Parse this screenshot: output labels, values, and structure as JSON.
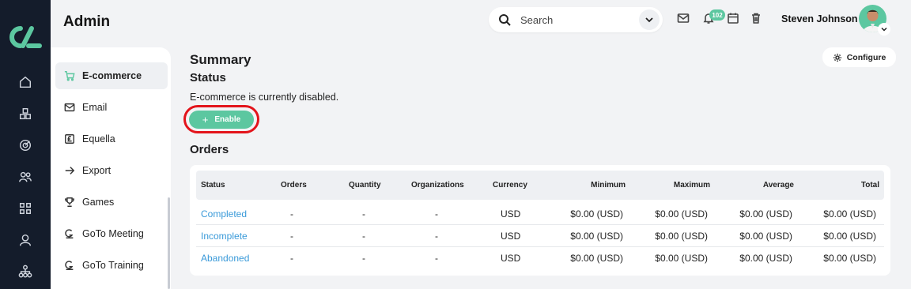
{
  "app": {
    "title": "Admin"
  },
  "colors": {
    "accent": "#5cc7a0",
    "rail": "#141c2b",
    "link": "#3a9ad9",
    "highlight_ring": "#e3141b"
  },
  "rail_icons": [
    "home-icon",
    "layers-icon",
    "target-icon",
    "users-icon",
    "grid-icon",
    "user-icon",
    "org-chart-icon"
  ],
  "header": {
    "search_placeholder": "Search",
    "notification_count": "102",
    "user_name": "Steven Johnson",
    "icons": [
      "mail-icon",
      "bell-icon",
      "calendar-icon",
      "trash-icon"
    ]
  },
  "subnav": {
    "items": [
      {
        "label": "E-commerce",
        "icon": "cart-icon",
        "active": true
      },
      {
        "label": "Email",
        "icon": "mail-icon"
      },
      {
        "label": "Equella",
        "icon": "pound-icon"
      },
      {
        "label": "Export",
        "icon": "arrow-right-icon"
      },
      {
        "label": "Games",
        "icon": "trophy-icon"
      },
      {
        "label": "GoTo Meeting",
        "icon": "goto-icon"
      },
      {
        "label": "GoTo Training",
        "icon": "goto-icon"
      }
    ]
  },
  "main": {
    "summary_title": "Summary",
    "status_title": "Status",
    "status_text": "E-commerce is currently disabled.",
    "enable_label": "Enable",
    "configure_label": "Configure",
    "orders_title": "Orders",
    "table": {
      "columns": [
        "Status",
        "Orders",
        "Quantity",
        "Organizations",
        "Currency",
        "Minimum",
        "Maximum",
        "Average",
        "Total"
      ],
      "rows": [
        [
          "Completed",
          "-",
          "-",
          "-",
          "USD",
          "$0.00 (USD)",
          "$0.00 (USD)",
          "$0.00 (USD)",
          "$0.00 (USD)"
        ],
        [
          "Incomplete",
          "-",
          "-",
          "-",
          "USD",
          "$0.00 (USD)",
          "$0.00 (USD)",
          "$0.00 (USD)",
          "$0.00 (USD)"
        ],
        [
          "Abandoned",
          "-",
          "-",
          "-",
          "USD",
          "$0.00 (USD)",
          "$0.00 (USD)",
          "$0.00 (USD)",
          "$0.00 (USD)"
        ]
      ]
    }
  }
}
